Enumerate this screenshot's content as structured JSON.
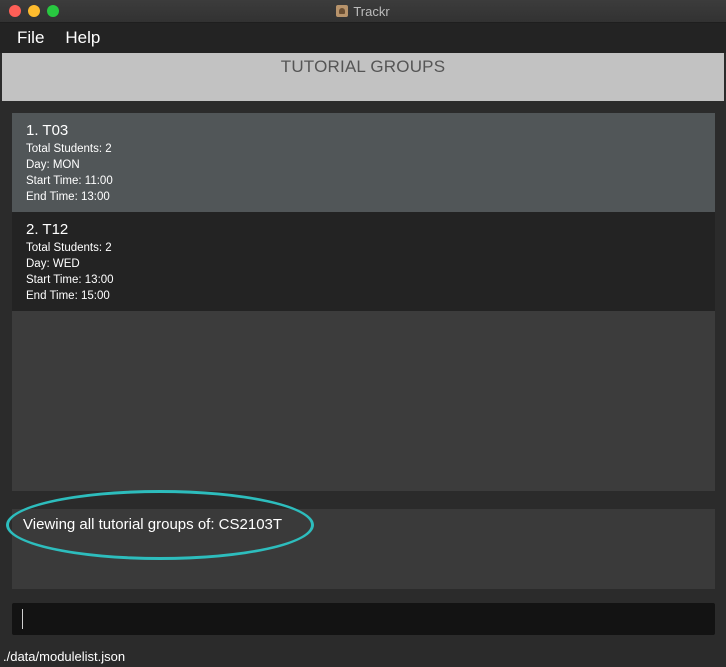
{
  "window": {
    "title": "Trackr"
  },
  "menu": {
    "items": [
      {
        "label": "File"
      },
      {
        "label": "Help"
      }
    ]
  },
  "header": {
    "title": "TUTORIAL GROUPS"
  },
  "tutorial_groups": [
    {
      "title": "1.  T03",
      "total_students": "Total Students: 2",
      "day": "Day: MON",
      "start_time": "Start Time: 11:00",
      "end_time": "End Time: 13:00",
      "selected": true
    },
    {
      "title": "2.  T12",
      "total_students": "Total Students: 2",
      "day": "Day: WED",
      "start_time": "Start Time: 13:00",
      "end_time": "End Time: 15:00",
      "selected": false
    }
  ],
  "result": {
    "message": "Viewing all tutorial groups of: CS2103T"
  },
  "command": {
    "value": ""
  },
  "status": {
    "file_path": "./data/modulelist.json"
  },
  "colors": {
    "highlight_ring": "#2dbdbd",
    "selected_card": "#515658",
    "header_bg": "#c2c2c2"
  }
}
